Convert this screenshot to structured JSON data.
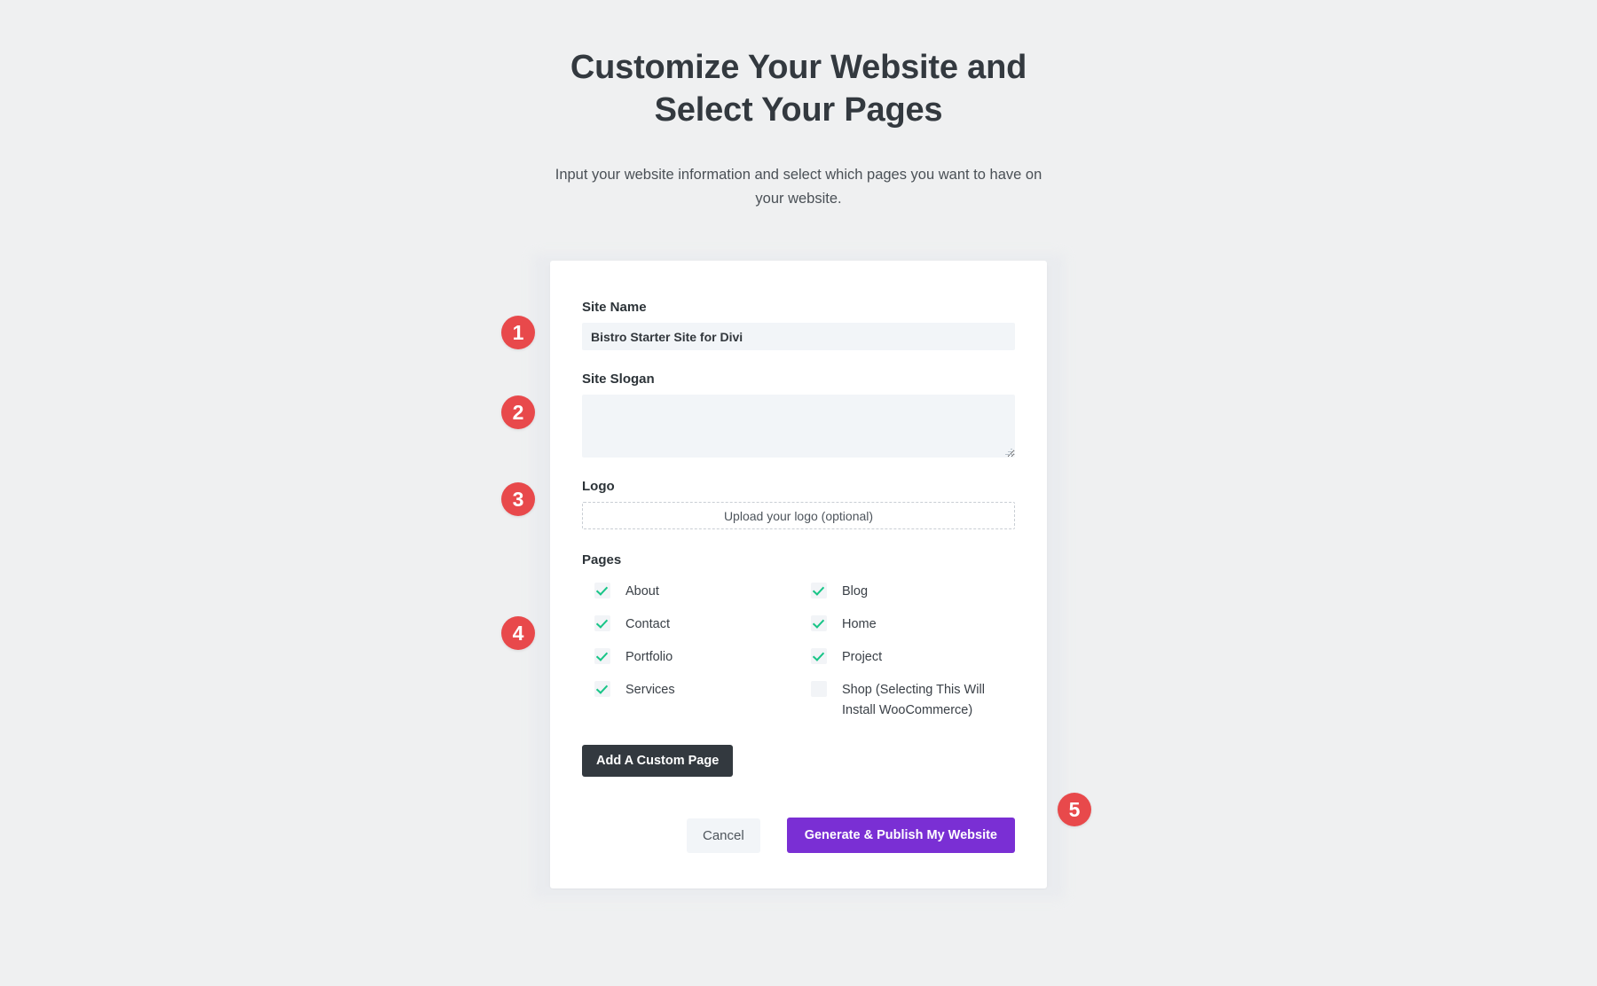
{
  "header": {
    "title": "Customize Your Website and Select Your Pages",
    "subtitle": "Input your website information and select which pages you want to have on your website."
  },
  "form": {
    "site_name": {
      "label": "Site Name",
      "value": "Bistro Starter Site for Divi",
      "placeholder": ""
    },
    "site_slogan": {
      "label": "Site Slogan",
      "value": "",
      "placeholder": ""
    },
    "logo": {
      "label": "Logo",
      "upload_text": "Upload your logo (optional)"
    },
    "pages": {
      "label": "Pages",
      "options": [
        {
          "label": "About",
          "checked": true
        },
        {
          "label": "Blog",
          "checked": true
        },
        {
          "label": "Contact",
          "checked": true
        },
        {
          "label": "Home",
          "checked": true
        },
        {
          "label": "Portfolio",
          "checked": true
        },
        {
          "label": "Project",
          "checked": true
        },
        {
          "label": "Services",
          "checked": true
        },
        {
          "label": "Shop (Selecting This Will Install WooCommerce)",
          "checked": false
        }
      ]
    },
    "add_custom_page_label": "Add A Custom Page"
  },
  "footer": {
    "cancel_label": "Cancel",
    "primary_label": "Generate & Publish My Website"
  },
  "badges": [
    {
      "number": "1"
    },
    {
      "number": "2"
    },
    {
      "number": "3"
    },
    {
      "number": "4"
    },
    {
      "number": "5"
    }
  ],
  "colors": {
    "page_background": "#eff0f1",
    "card_background": "#ffffff",
    "badge_red": "#e8494b",
    "primary_purple": "#7a2fd4",
    "dark_button": "#33393f",
    "input_background": "#f2f5f8",
    "check_green": "#18c587"
  }
}
